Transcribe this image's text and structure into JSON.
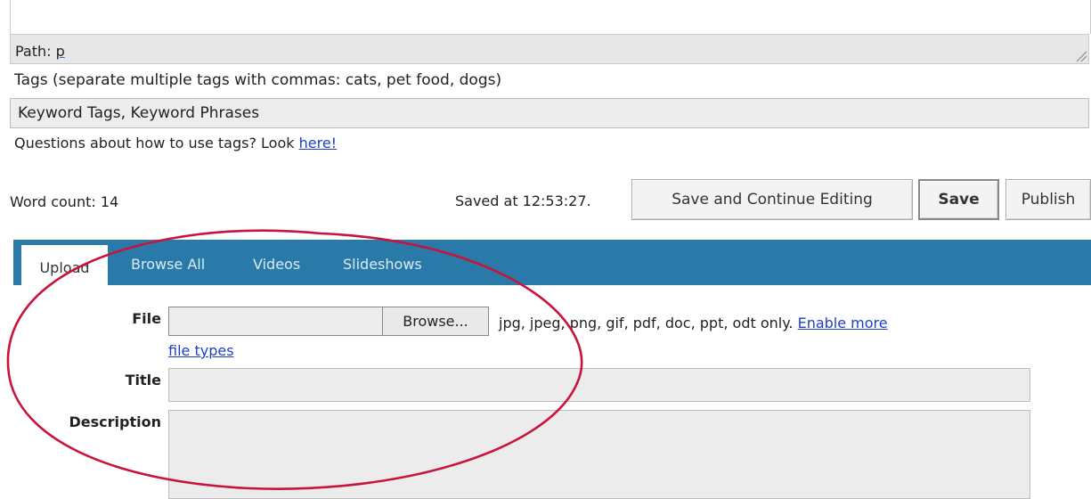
{
  "editor": {
    "path_label": "Path:",
    "path_value": "p"
  },
  "tags": {
    "help": "Tags (separate multiple tags with commas: cats, pet food, dogs)",
    "value": "Keyword Tags, Keyword Phrases",
    "question": "Questions about how to use tags? Look",
    "link": "here!"
  },
  "status": {
    "word_count": "Word count: 14",
    "saved_at": "Saved at 12:53:27."
  },
  "buttons": {
    "save_continue": "Save and Continue Editing",
    "save": "Save",
    "publish": "Publish"
  },
  "media": {
    "tabs": [
      "Upload",
      "Browse All",
      "Videos",
      "Slideshows"
    ],
    "file_label": "File",
    "browse_label": "Browse...",
    "file_types": "jpg, jpeg, png, gif, pdf, doc, ppt, odt only.",
    "enable_more": "Enable more",
    "file_types_link": "file types",
    "title_label": "Title",
    "description_label": "Description"
  },
  "colors": {
    "tab_bar": "#2a7aa9",
    "link": "#1e3ec8",
    "highlight": "#c8143c"
  }
}
